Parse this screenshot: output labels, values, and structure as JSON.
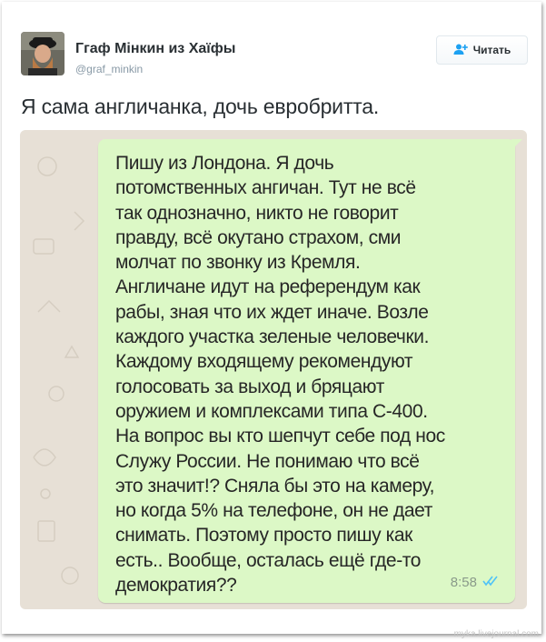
{
  "tweet": {
    "author_name": "Ггаф Мінкин из Хаїфы",
    "author_handle": "@graf_minkin",
    "follow_label": "Читать",
    "text": "Я сама англичанка, дочь евробритта."
  },
  "chat": {
    "message": "Пишу из Лондона. Я дочь\nпотомственных ангичан. Тут не всё\nтак однозначно, никто не говорит\nправду, всё окутано страхом, сми\nмолчат по звонку из Кремля.\nАнгличане идут на референдум как\nрабы, зная что их ждет иначе. Возле\nкаждого участка зеленые человечки.\nКаждому входящему рекомендуют\nголосовать за выход и бряцают\nоружием и комплексами типа С-400.\nНа вопрос вы кто шепчут себе под нос\nСлужу России. Не понимаю что всё\nэто значит!? Сняла бы это на камеру,\nно когда 5% на телефоне, он не дает\nснимать. Поэтому просто пишу как\nесть.. Вообще, осталась ещё где-то\nдемократия??",
    "time": "8:58",
    "status": "read",
    "colors": {
      "bubble": "#dcf8c6",
      "background": "#e7e0d6",
      "read_ticks": "#4fc3f7"
    }
  },
  "watermark": "myka.livejournal.com",
  "colors": {
    "follow_icon": "#1da1f2",
    "name": "#292f33",
    "handle": "#8899a6"
  },
  "icons": {
    "follow": "person-add-icon",
    "read": "double-check-icon"
  }
}
